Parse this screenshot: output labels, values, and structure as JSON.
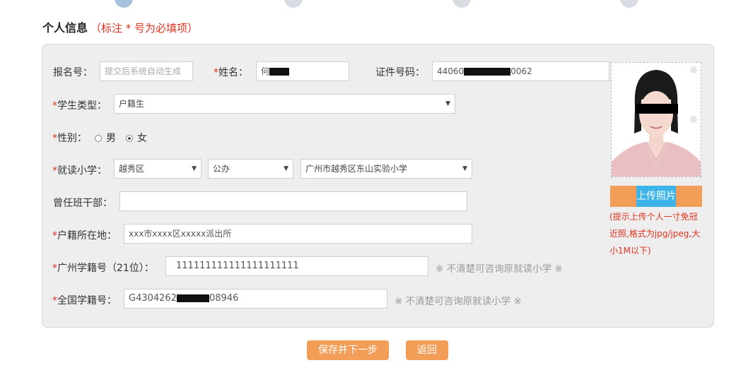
{
  "section": {
    "title": "个人信息",
    "note": "（标注 * 号为必填项）"
  },
  "form": {
    "reg_no": {
      "label": "报名号：",
      "placeholder": "提交后系统自动生成"
    },
    "name": {
      "star": "*",
      "label": "姓名：",
      "value_prefix": "何"
    },
    "id_no": {
      "label": "证件号码：",
      "value_prefix": "44060",
      "value_suffix": "0062"
    },
    "student_type": {
      "star": "*",
      "label": "学生类型：",
      "value": "户籍生"
    },
    "gender": {
      "star": "*",
      "label": "性别：",
      "male": "男",
      "female": "女",
      "selected": "女"
    },
    "school": {
      "star": "*",
      "label": "就读小学：",
      "district": "越秀区",
      "type": "公办",
      "name": "广州市越秀区东山实验小学"
    },
    "cadre": {
      "label": "曾任班干部：",
      "value": ""
    },
    "household": {
      "star": "*",
      "label": "户籍所在地：",
      "value": "xxx市xxxx区xxxxx派出所"
    },
    "gz_no": {
      "star": "*",
      "label": "广州学籍号（21位）：",
      "value": "111111111111111111111",
      "hint": "※ 不清楚可咨询原就读小学 ※"
    },
    "national_no": {
      "star": "*",
      "label": "全国学籍号：",
      "value_prefix": "G4304262",
      "value_suffix": "08946",
      "hint": "※ 不清楚可咨询原就读小学 ※"
    }
  },
  "photo": {
    "upload_label": "上传照片",
    "tip": "(提示上传个人一寸免冠近照,格式为jpg/jpeg,大小1M以下)"
  },
  "buttons": {
    "save": "保存并下一步",
    "back": "返回"
  },
  "colors": {
    "accent": "#f29d58",
    "required": "#e0321f",
    "upload_blue": "#3cb4e8"
  }
}
